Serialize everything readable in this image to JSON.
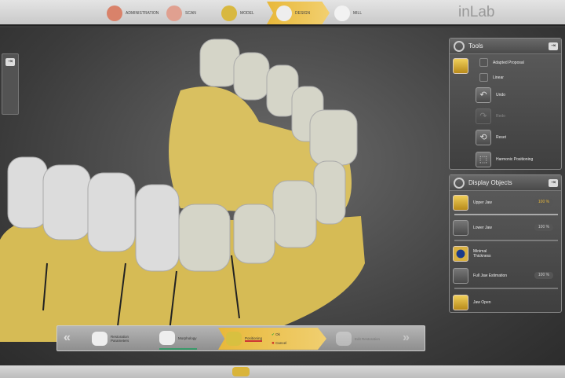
{
  "topbar": {
    "steps": [
      {
        "label": "Administration"
      },
      {
        "label": "Scan"
      },
      {
        "label": "Model"
      },
      {
        "label": "Design"
      },
      {
        "label": "Mill"
      }
    ],
    "brand": "inLab"
  },
  "tools": {
    "title": "Tools",
    "items": [
      "Adapted Proposal",
      "Linear",
      "Undo",
      "Redo",
      "Reset",
      "Harmonic Positioning"
    ]
  },
  "display_objects": {
    "title": "Display Objects",
    "items": [
      {
        "label": "Upper Jaw",
        "percent": "100 %",
        "slider": 1.0
      },
      {
        "label": "Lower Jaw",
        "percent": "100 %",
        "slider": 1.0
      },
      {
        "label": "Minimal Thickness"
      },
      {
        "label": "Full Jaw Estimation",
        "percent": "100 %",
        "slider": 1.0
      },
      {
        "label": "Jaw Open"
      }
    ]
  },
  "wizard": {
    "steps": [
      "Restoration Parameters",
      "Morphology",
      "Positioning",
      "Edit Restoration"
    ],
    "ok": "Ok",
    "cancel": "Cancel"
  },
  "colors": {
    "accent": "#e8b83a",
    "jaw": "#d9bf5a",
    "tooth": "#d8d8cc"
  }
}
